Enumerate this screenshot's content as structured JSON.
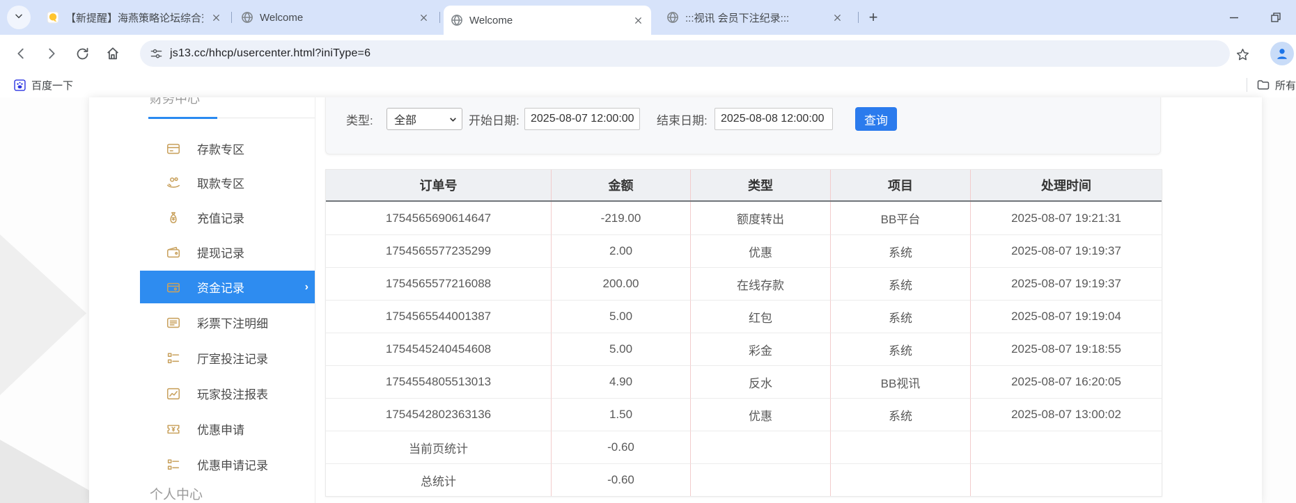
{
  "browser": {
    "tabs": [
      {
        "title": "【新提醒】海燕策略论坛综合交",
        "favicon": "yellow-app-icon",
        "active": false
      },
      {
        "title": "Welcome",
        "favicon": "globe-icon",
        "active": false
      },
      {
        "title": "Welcome",
        "favicon": "globe-icon",
        "active": true
      },
      {
        "title": ":::视讯 会员下注纪录:::",
        "favicon": "globe-icon",
        "active": false
      }
    ],
    "url": "js13.cc/hhcp/usercenter.html?iniType=6",
    "bookmark_label": "百度一下",
    "all_bookmarks_label": "所有书签",
    "icons": {
      "tabstrip": [
        "tab-search-chevron-icon",
        "close-icon",
        "new-tab-plus-icon",
        "minimize-icon",
        "restore-icon"
      ],
      "toolbar": [
        "back-icon",
        "forward-icon",
        "reload-icon",
        "home-icon",
        "site-info-icon",
        "bookmark-star-icon",
        "profile-avatar-icon"
      ],
      "bookmarks": [
        "baidu-icon",
        "folder-icon"
      ]
    }
  },
  "sidebar": {
    "section_title": "财务中心",
    "items": [
      {
        "label": "存款专区",
        "name": "deposit-zone",
        "icon": "bank-card-icon",
        "active": false
      },
      {
        "label": "取款专区",
        "name": "withdraw-zone",
        "icon": "hand-coin-icon",
        "active": false
      },
      {
        "label": "充值记录",
        "name": "recharge-records",
        "icon": "money-bag-icon",
        "active": false
      },
      {
        "label": "提现记录",
        "name": "withdrawal-records",
        "icon": "wallet-out-icon",
        "active": false
      },
      {
        "label": "资金记录",
        "name": "funds-records",
        "icon": "funds-wallet-icon",
        "active": true
      },
      {
        "label": "彩票下注明细",
        "name": "lottery-bet-details",
        "icon": "detail-card-icon",
        "active": false
      },
      {
        "label": "厅室投注记录",
        "name": "hall-bet-records",
        "icon": "list-icon",
        "active": false
      },
      {
        "label": "玩家投注报表",
        "name": "player-bet-report",
        "icon": "chart-icon",
        "active": false
      },
      {
        "label": "优惠申请",
        "name": "promo-apply",
        "icon": "ticket-icon",
        "active": false
      },
      {
        "label": "优惠申请记录",
        "name": "promo-apply-records",
        "icon": "list-icon",
        "active": false
      }
    ],
    "footer_section_title": "个人中心"
  },
  "filters": {
    "type_label": "类型:",
    "type_value": "全部",
    "start_label": "开始日期:",
    "start_value": "2025-08-07 12:00:00",
    "end_label": "结束日期:",
    "end_value": "2025-08-08 12:00:00",
    "query_button": "查询"
  },
  "table": {
    "headers": [
      "订单号",
      "金额",
      "类型",
      "项目",
      "处理时间"
    ],
    "rows": [
      [
        "1754565690614647",
        "-219.00",
        "额度转出",
        "BB平台",
        "2025-08-07 19:21:31"
      ],
      [
        "1754565577235299",
        "2.00",
        "优惠",
        "系统",
        "2025-08-07 19:19:37"
      ],
      [
        "1754565577216088",
        "200.00",
        "在线存款",
        "系统",
        "2025-08-07 19:19:37"
      ],
      [
        "1754565544001387",
        "5.00",
        "红包",
        "系统",
        "2025-08-07 19:19:04"
      ],
      [
        "1754545240454608",
        "5.00",
        "彩金",
        "系统",
        "2025-08-07 19:18:55"
      ],
      [
        "1754554805513013",
        "4.90",
        "反水",
        "BB视讯",
        "2025-08-07 16:20:05"
      ],
      [
        "1754542802363136",
        "1.50",
        "优惠",
        "系统",
        "2025-08-07 13:00:02"
      ]
    ],
    "summary_rows": [
      [
        "当前页统计",
        "-0.60",
        "",
        "",
        ""
      ],
      [
        "总统计",
        "-0.60",
        "",
        "",
        ""
      ]
    ]
  },
  "colors": {
    "tabstrip_bg": "#d7e3fa",
    "active_sidebar_blue": "#2e8cf0",
    "query_button_blue": "#2b7bed",
    "gold_icon": "#c9a25f",
    "table_header_bg": "#eef0f3",
    "column_divider_pink": "#f2cccc",
    "avatar_blue": "#1a73e8"
  }
}
